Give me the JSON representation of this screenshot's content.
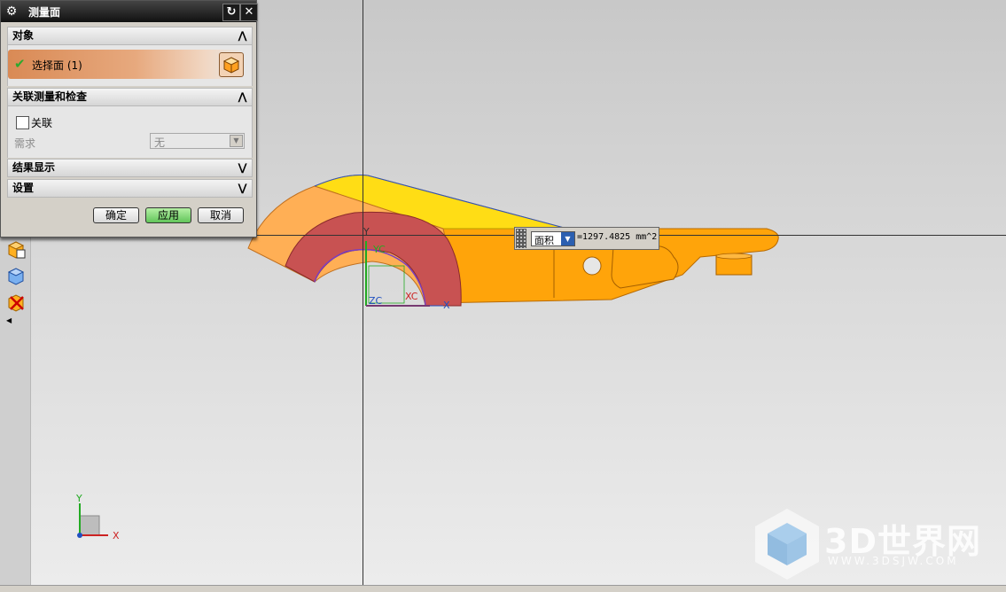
{
  "dialog": {
    "title": "测量面",
    "sections": {
      "object": "对象",
      "associative": "关联测量和检查",
      "results": "结果显示",
      "settings": "设置"
    },
    "select_face_label": "选择面 (1)",
    "associate_label": "关联",
    "requirement_label": "需求",
    "requirement_value": "无",
    "buttons": {
      "ok": "确定",
      "apply": "应用",
      "cancel": "取消"
    }
  },
  "measurement": {
    "type": "面积",
    "value": "=1297.4825 mm^2"
  },
  "axes": {
    "wcs": {
      "y": "Y",
      "yc": "YC",
      "zc": "ZC",
      "xc": "XC",
      "x": "X"
    },
    "triad": {
      "y": "Y",
      "x": "X"
    }
  },
  "watermark": {
    "brand": "3D世界网",
    "url": "WWW.3DSJW.COM"
  },
  "colors": {
    "part_orange": "#ffa500",
    "part_light_orange": "#ffb060",
    "part_yellow": "#ffdd22",
    "selected_face": "#c85050",
    "apply_green": "#62c55a"
  }
}
